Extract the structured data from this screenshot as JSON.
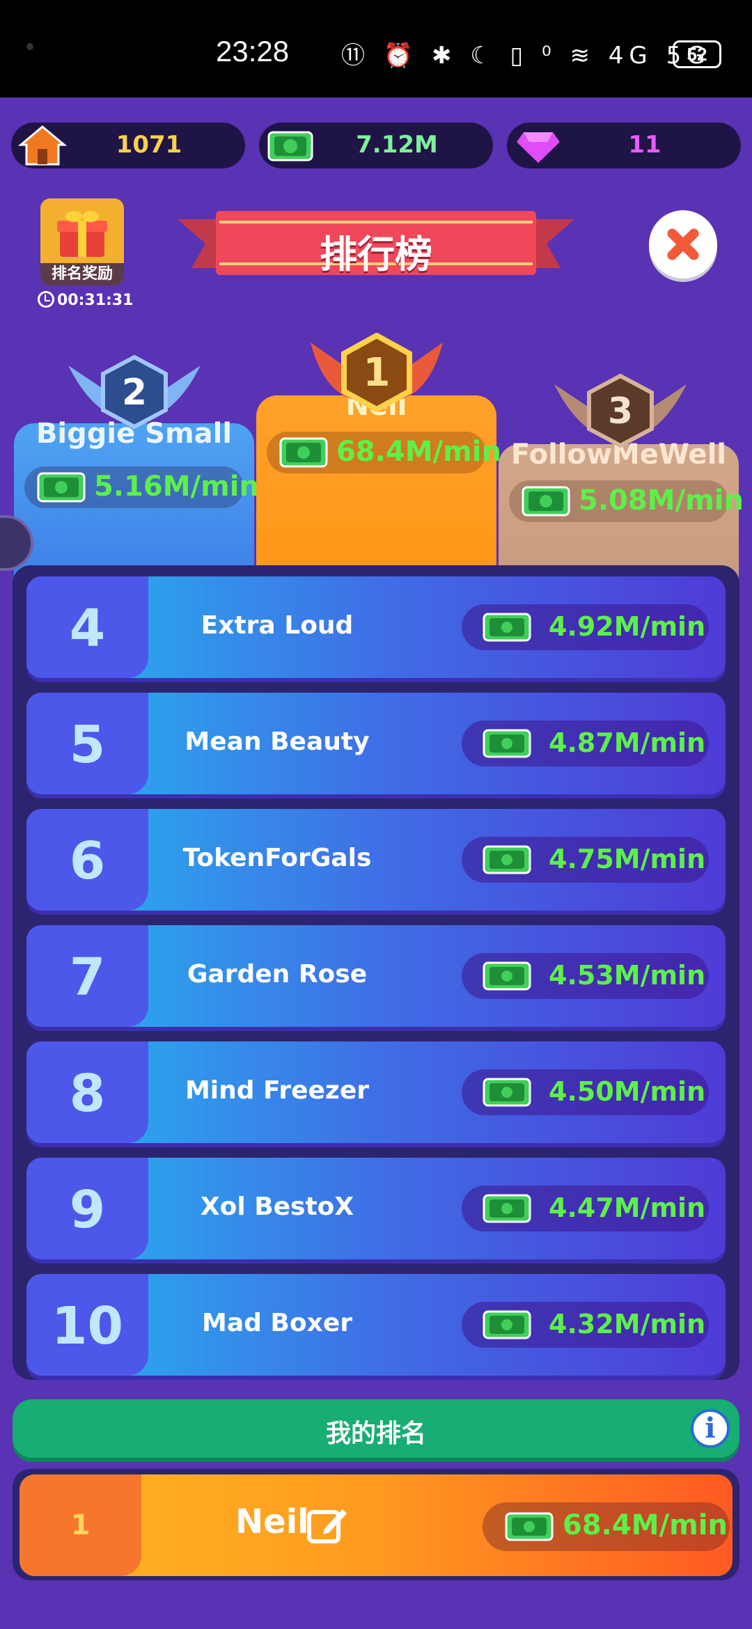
{
  "status_bar": {
    "time": "23:28",
    "icons_text": "⑪ ⏰ ✱ ☾ ▯ ⁰ ≋ 4G 5G",
    "battery": "52"
  },
  "currencies": [
    {
      "icon": "house-icon",
      "value": "1071",
      "color": "#f9d04f"
    },
    {
      "icon": "cash-icon",
      "value": "7.12M",
      "color": "#7df09a"
    },
    {
      "icon": "gem-icon",
      "value": "11",
      "color": "#e65cff"
    }
  ],
  "reward": {
    "label": "排名奖励",
    "timer": "00:31:31"
  },
  "title": "排行榜",
  "podium": [
    {
      "rank": "2",
      "name": "Biggie Small",
      "rate": "5.16M/min"
    },
    {
      "rank": "1",
      "name": "Neil",
      "rate": "68.4M/min"
    },
    {
      "rank": "3",
      "name": "FollowMeWell",
      "rate": "5.08M/min"
    }
  ],
  "rows": [
    {
      "rank": "4",
      "name": "Extra Loud",
      "rate": "4.92M/min"
    },
    {
      "rank": "5",
      "name": "Mean Beauty",
      "rate": "4.87M/min"
    },
    {
      "rank": "6",
      "name": "TokenForGals",
      "rate": "4.75M/min"
    },
    {
      "rank": "7",
      "name": "Garden Rose",
      "rate": "4.53M/min"
    },
    {
      "rank": "8",
      "name": "Mind Freezer",
      "rate": "4.50M/min"
    },
    {
      "rank": "9",
      "name": "Xol BestoX",
      "rate": "4.47M/min"
    },
    {
      "rank": "10",
      "name": "Mad Boxer",
      "rate": "4.32M/min"
    }
  ],
  "my_ranking": {
    "title": "我的排名",
    "rank": "1",
    "name": "Neil",
    "rate": "68.4M/min"
  }
}
